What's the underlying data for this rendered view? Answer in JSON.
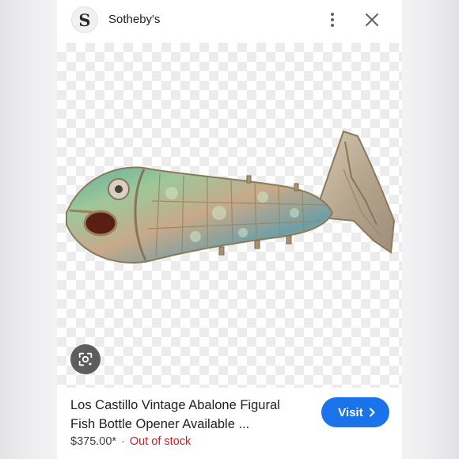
{
  "header": {
    "logo_letter": "S",
    "site_name": "Sotheby's"
  },
  "icons": {
    "more": "more-vertical-icon",
    "close": "close-icon",
    "lens": "lens-icon",
    "chevron": "chevron-right-icon"
  },
  "product": {
    "title_line1": "Los Castillo Vintage Abalone Figural",
    "title_line2": "Fish Bottle Opener Available ...",
    "price": "$375.00*",
    "separator": "·",
    "stock_status": "Out of stock"
  },
  "actions": {
    "visit_label": "Visit"
  },
  "colors": {
    "accent": "#1a73e8",
    "out_of_stock": "#c5221f"
  }
}
